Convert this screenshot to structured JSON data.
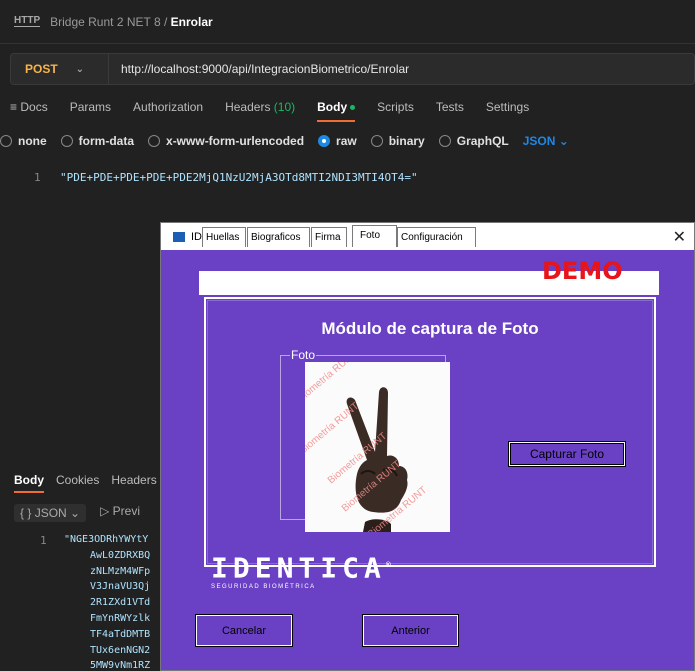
{
  "header": {
    "http_icon": "HTTP",
    "collection": "Bridge Runt 2 NET 8",
    "separator": "/",
    "request_name": "Enrolar"
  },
  "request": {
    "method": "POST",
    "url": "http://localhost:9000/api/IntegracionBiometrico/Enrolar"
  },
  "tabs": [
    {
      "label": "Docs",
      "icon": "docs-icon"
    },
    {
      "label": "Params"
    },
    {
      "label": "Authorization"
    },
    {
      "label": "Headers",
      "badge": "(10)"
    },
    {
      "label": "Body",
      "active": true
    },
    {
      "label": "Scripts"
    },
    {
      "label": "Tests"
    },
    {
      "label": "Settings"
    }
  ],
  "body_options": [
    "none",
    "form-data",
    "x-www-form-urlencoded",
    "raw",
    "binary",
    "GraphQL"
  ],
  "body_selected": "raw",
  "body_format": "JSON",
  "request_body": {
    "line_number": "1",
    "text": "\"PDE+PDE+PDE+PDE+PDE2MjQ1NzU2MjA3OTd8MTI2NDI3MTI4OT4=\""
  },
  "response": {
    "tabs": [
      "Body",
      "Cookies",
      "Headers"
    ],
    "format": "JSON",
    "preview_label": "Previ",
    "line_number": "1",
    "lines": [
      "\"NGE3ODRhYWYtY",
      "AwL0ZDRXBQ",
      "zNLMzM4WFp",
      "V3JnaVU3Qj",
      "2R1ZXd1VTd",
      "FmYnRWYzlk",
      "TF4aTdDMTB",
      "TUx6enNGN2",
      "5MW9vNm1RZ"
    ]
  },
  "dialog": {
    "title": "IDRUNT",
    "tabs": [
      "Huellas",
      "Biograficos",
      "Firma",
      "Foto",
      "Configuración"
    ],
    "active_tab": "Foto",
    "demo_label": "DEMO",
    "module_title": "Módulo de captura de Foto",
    "photo_group_label": "Foto",
    "watermark": "Biometría RUNT",
    "capture_button": "Capturar Foto",
    "brand": "IDENTICA",
    "brand_mark": "®",
    "brand_tagline": "SEGURIDAD BIOMÉTRICA",
    "cancel_button": "Cancelar",
    "back_button": "Anterior"
  }
}
